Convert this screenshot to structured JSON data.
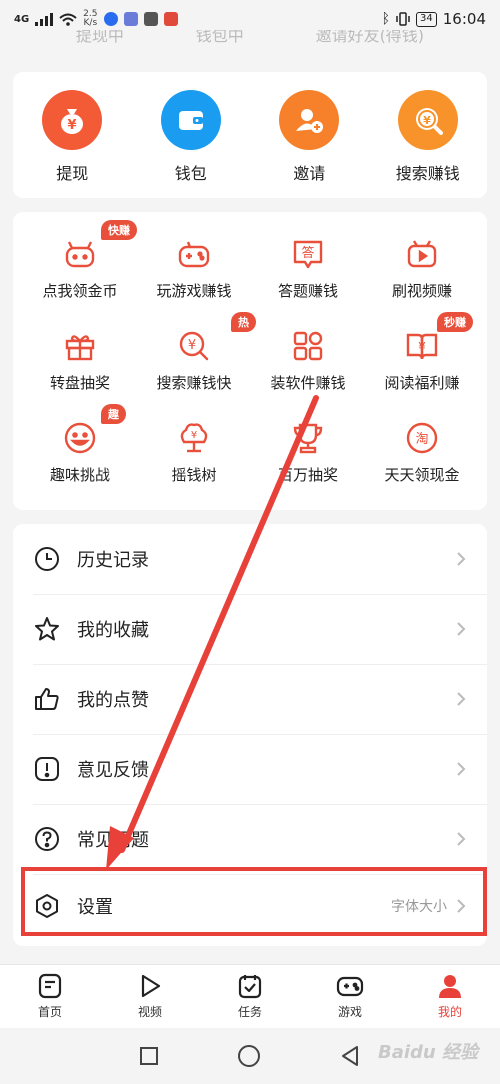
{
  "status_bar": {
    "signal": "4G",
    "speed_value": "2.5",
    "speed_unit": "K/s",
    "battery": "34",
    "time": "16:04"
  },
  "faded_header": [
    "提现中",
    "钱包中",
    "邀请好友(得钱)"
  ],
  "quick_actions": [
    {
      "label": "提现",
      "icon": "money-bag-icon",
      "color": "#f25b36"
    },
    {
      "label": "钱包",
      "icon": "wallet-icon",
      "color": "#1a9df0"
    },
    {
      "label": "邀请",
      "icon": "invite-user-icon",
      "color": "#f7812a"
    },
    {
      "label": "搜索赚钱",
      "icon": "search-coin-icon",
      "color": "#f7932a"
    }
  ],
  "earn_grid": [
    {
      "label": "点我领金币",
      "badge": "快赚",
      "icon": "robot-icon"
    },
    {
      "label": "玩游戏赚钱",
      "badge": "",
      "icon": "gamepad-icon"
    },
    {
      "label": "答题赚钱",
      "badge": "",
      "icon": "quiz-icon"
    },
    {
      "label": "刷视频赚",
      "badge": "",
      "icon": "video-icon"
    },
    {
      "label": "转盘抽奖",
      "badge": "",
      "icon": "gift-icon"
    },
    {
      "label": "搜索赚钱快",
      "badge": "热",
      "icon": "search-coin-icon"
    },
    {
      "label": "装软件赚钱",
      "badge": "",
      "icon": "apps-icon"
    },
    {
      "label": "阅读福利赚",
      "badge": "秒赚",
      "icon": "book-coin-icon"
    },
    {
      "label": "趣味挑战",
      "badge": "趣",
      "icon": "smile-icon"
    },
    {
      "label": "摇钱树",
      "badge": "",
      "icon": "money-tree-icon"
    },
    {
      "label": "百万抽奖",
      "badge": "",
      "icon": "trophy-icon"
    },
    {
      "label": "天天领现金",
      "badge": "",
      "icon": "taobao-icon"
    }
  ],
  "menu_list": [
    {
      "label": "历史记录",
      "icon": "clock-icon",
      "extra": ""
    },
    {
      "label": "我的收藏",
      "icon": "star-icon",
      "extra": ""
    },
    {
      "label": "我的点赞",
      "icon": "thumbs-up-icon",
      "extra": ""
    },
    {
      "label": "意见反馈",
      "icon": "feedback-icon",
      "extra": ""
    },
    {
      "label": "常见问题",
      "icon": "question-icon",
      "extra": ""
    },
    {
      "label": "设置",
      "icon": "settings-icon",
      "extra": "字体大小"
    }
  ],
  "bottom_nav": [
    {
      "label": "首页",
      "icon": "home-doc-icon",
      "active": false
    },
    {
      "label": "视频",
      "icon": "play-icon",
      "active": false
    },
    {
      "label": "任务",
      "icon": "task-calendar-icon",
      "active": false
    },
    {
      "label": "游戏",
      "icon": "gamepad-icon",
      "active": false
    },
    {
      "label": "我的",
      "icon": "user-icon",
      "active": true
    }
  ],
  "watermark": "Baidu 经验",
  "colors": {
    "accent": "#e8413a",
    "icon_red": "#e8503b",
    "annotation": "#e8413a"
  }
}
